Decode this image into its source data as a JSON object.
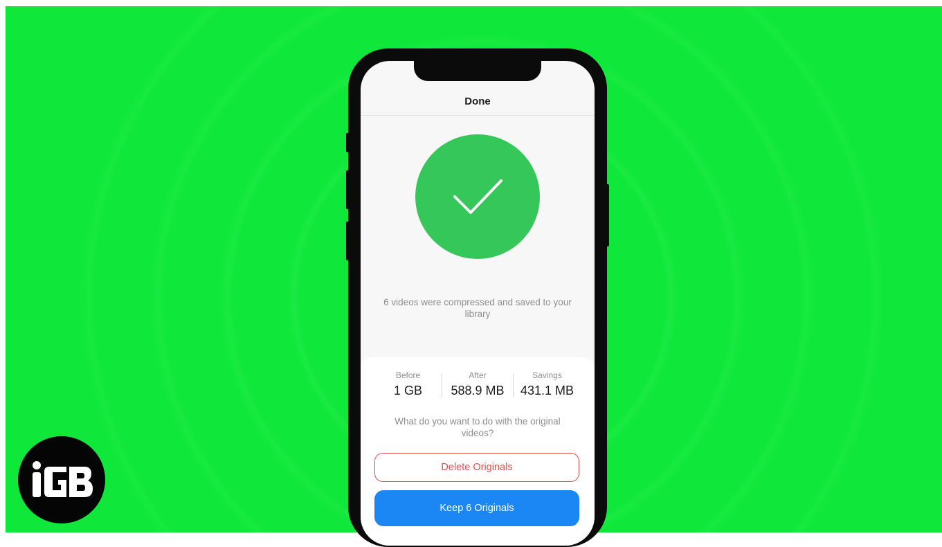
{
  "screen": {
    "nav_title": "Done",
    "message": "6 videos were compressed and saved to your library",
    "stats": [
      {
        "label": "Before",
        "value": "1 GB"
      },
      {
        "label": "After",
        "value": "588.9 MB"
      },
      {
        "label": "Savings",
        "value": "431.1 MB"
      }
    ],
    "question": "What do you want to do with the original videos?",
    "delete_label": "Delete Originals",
    "keep_label": "Keep 6 Originals"
  },
  "logo": {
    "text": "iGB"
  },
  "icons": {
    "success": "checkmark-icon"
  },
  "colors": {
    "background": "#0fe83a",
    "success": "#35c759",
    "destructive": "#e0514c",
    "primary": "#1b87f5"
  }
}
